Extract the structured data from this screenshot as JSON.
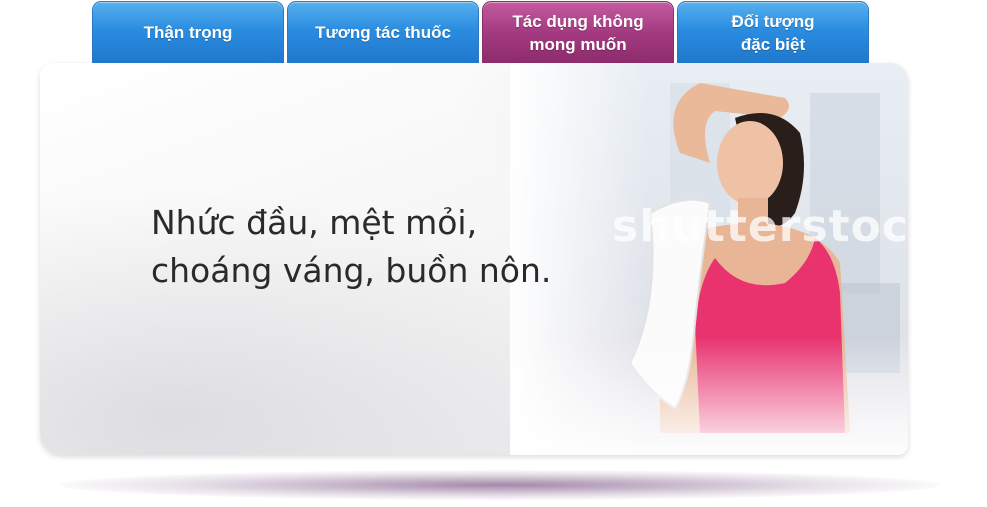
{
  "tabs": [
    {
      "lines": [
        "Thận trọng"
      ],
      "active": false
    },
    {
      "lines": [
        "Tương tác thuốc"
      ],
      "active": false
    },
    {
      "lines": [
        "Tác dụng không",
        "mong muốn"
      ],
      "active": true
    },
    {
      "lines": [
        "Đối tượng",
        "đặc biệt"
      ],
      "active": false
    }
  ],
  "content": {
    "message_lines": [
      "Nhức đầu, mệt mỏi,",
      "choáng váng, buồn nôn."
    ],
    "watermark": "shutterstock"
  },
  "colors": {
    "tab_blue": "#2b8de0",
    "tab_active": "#a43a80",
    "text": "#2a2a2a",
    "tank_top_pink": "#e8336f"
  },
  "image": {
    "icon": "woman-wiping-forehead-photo"
  }
}
